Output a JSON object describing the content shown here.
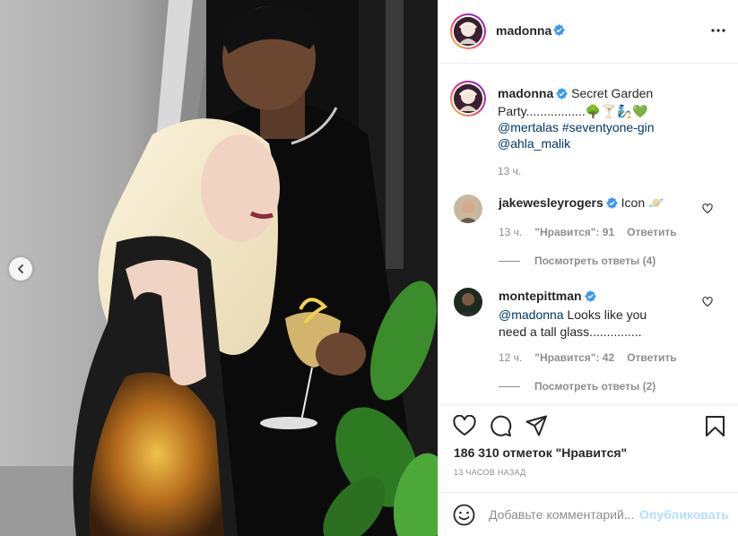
{
  "post": {
    "author": "madonna",
    "verified": true
  },
  "caption": {
    "username": "madonna",
    "text": "Secret Garden Party.................",
    "emojis": "🌳🍸🧞💚",
    "mention1": "@mertalas",
    "hashtag": "#seventyone-gin",
    "mention2": "@ahla_malik",
    "time": "13 ч."
  },
  "comments": [
    {
      "username": "jakewesleyrogers",
      "verified": true,
      "text": "Icon",
      "emoji": "🪐",
      "time": "13 ч.",
      "likes": "\"Нравится\": 91",
      "reply": "Ответить",
      "view_replies": "Посмотреть ответы (4)"
    },
    {
      "username": "montepittman",
      "verified": true,
      "mention": "@madonna",
      "text": "Looks like you need a tall glass...............",
      "time": "12 ч.",
      "likes": "\"Нравится\": 42",
      "reply": "Ответить",
      "view_replies": "Посмотреть ответы (2)"
    }
  ],
  "actions": {
    "icons": [
      "heart-icon",
      "comment-icon",
      "share-icon",
      "bookmark-icon"
    ],
    "likes_count": "186 310 отметок \"Нравится\"",
    "posted_ago": "13 ЧАСОВ НАЗАД"
  },
  "add_comment": {
    "placeholder": "Добавьте комментарий...",
    "publish_label": "Опубликовать"
  },
  "colors": {
    "verified_blue": "#3897f0",
    "link_blue": "#00376b",
    "publish_disabled": "#b2dffc",
    "muted_gray": "#8e8e8e"
  }
}
